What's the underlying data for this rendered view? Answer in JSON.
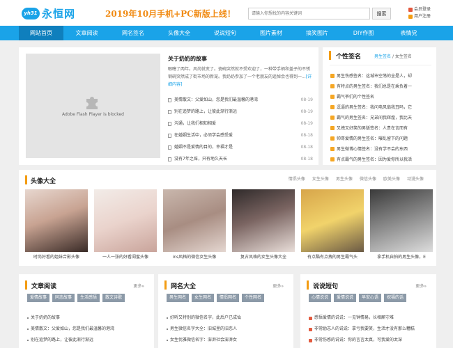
{
  "brand": {
    "badge": "yh31",
    "name": "永恒网"
  },
  "promo": "2019年10月手机+PC新版上线！",
  "search": {
    "placeholder": "请输入你想找的内容关键词",
    "button": "搜索"
  },
  "user": {
    "login": "会员登录",
    "register": "用户注册"
  },
  "nav": [
    "网站首页",
    "文章阅读",
    "网名签名",
    "头像大全",
    "说说短句",
    "图片素材",
    "搞笑图片",
    "DIY作图",
    "表情党"
  ],
  "flash": {
    "message": "Adobe Flash Player is blocked"
  },
  "featured": {
    "title": "关于奶奶的故事",
    "desc": "眼瞎了两年。风尚就变了。瓷碗突然就不受欢迎了，一种带手柄和盖子的不锈钢碗突然成了街市场的新宠。我奶奶参加了一个老朋友的追悼会也得到一...",
    "more": "[详细内容]",
    "list": [
      {
        "title": "美情散文：父爱如山，您是我们最温馨的港湾",
        "date": "08-19"
      },
      {
        "title": "别在追梦的路上，让彼此渐行渐远",
        "date": "08-19"
      },
      {
        "title": "沟通，让我们相知相爱",
        "date": "08-19"
      },
      {
        "title": "在婚姻生活中，必须学会感受爱",
        "date": "08-18"
      },
      {
        "title": "婚姻不是爱情的目的，幸福才是",
        "date": "08-18"
      },
      {
        "title": "没有7年之痒，只有地久天长",
        "date": "08-18"
      }
    ]
  },
  "signatures": {
    "title": "个性签名",
    "tab_active": "男生签名",
    "tab_sep": "/",
    "tab_other": "女生签名",
    "items": [
      "男生伤感签名：这城市空荡的全是人，却",
      "有特点的男生签名：我们总是在乘负着一",
      "霸气爷们的个性签名",
      "逗逼的男生签名：我问电风扇我丑吗，它",
      "霸气的男生签名：兄弟间我辉煌，我比天",
      "又拽又好笑的男版签名：人贵在言而有",
      "帅哥爱情的男生签名：曝乱留下的问题",
      "男生微博心情签名：没有学不会的东西",
      "有点霸气的男生签名：因为爱你所以我活"
    ]
  },
  "avatars": {
    "title": "头像大全",
    "tabs": [
      "情侣头像",
      "女生头像",
      "男生头像",
      "微信头像",
      "欧美头像",
      "动漫头像"
    ],
    "captions": [
      "时尚好看的姐妹合影头像",
      "一人一张的好看闺蜜头像",
      "ins风格的微信女生头像",
      "复古风格的女生头像大全",
      "有点酷有点拽的男生霸气头",
      "拿手机自拍的男生头像，E"
    ]
  },
  "cards": [
    {
      "title": "文章阅读",
      "more": "更多»",
      "chips": [
        "爱情故事",
        "同态故事",
        "生活感悟",
        "散文诗歌"
      ],
      "items": [
        "关于奶奶的故事",
        "美情散文：父爱如山，您是我们最温馨的港湾",
        "别在追梦的路上，让彼此渐行渐远"
      ]
    },
    {
      "title": "网名大全",
      "more": "更多»",
      "chips": [
        "男生网名",
        "女生网名",
        "情侣网名",
        "个性网名"
      ],
      "items": [
        "好听又特别的微信名字，此后户已成仙",
        "男生微信名字大全：旧城里的旧恋人",
        "女生优雅微信名字：澎湃社会澎湃女"
      ]
    },
    {
      "title": "说说短句",
      "more": "更多»",
      "chips": [
        "心情说说",
        "爱情说说",
        "早安心语",
        "祝福的话"
      ],
      "items": [
        "感悟爱情的说说：一见钟情易，长相厮守难",
        "非常励志人的说说：拿亏我要笑，生活才没有那么糟糕",
        "非常伤感的说说：你的言言太真，可我爱的太深"
      ]
    }
  ],
  "colors": {
    "brand": "#1aa3e8",
    "accent": "#f39c12",
    "nav_active": "#0f7fbd"
  }
}
